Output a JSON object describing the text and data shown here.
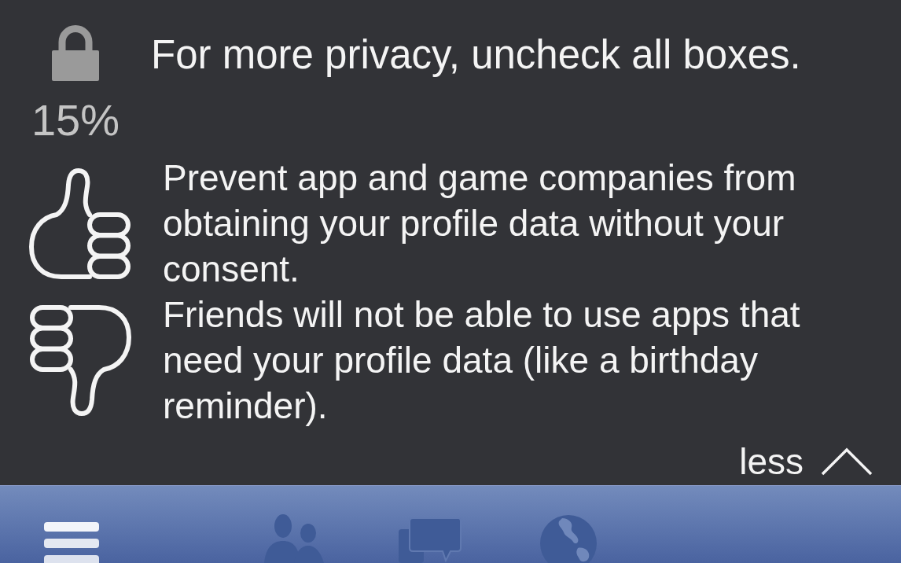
{
  "privacy_score": "15%",
  "instruction": "For more privacy, uncheck all boxes.",
  "consequences": [
    {
      "kind": "benefit",
      "text": "Prevent app and game companies from obtaining your profile data without your consent."
    },
    {
      "kind": "drawback",
      "text": "Friends will not be able to use apps that need your profile data (like a birthday reminder)."
    }
  ],
  "toggle": {
    "label": "less",
    "expanded": true
  }
}
